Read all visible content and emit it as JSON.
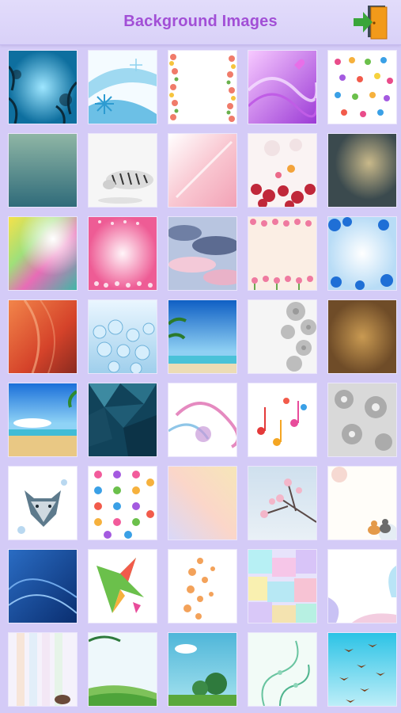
{
  "header": {
    "title": "Background Images"
  },
  "icons": {
    "exit": "exit-door-icon"
  },
  "tiles": [
    "blue-trees-thumbnail",
    "blue-snowflake-thumbnail",
    "flower-border-thumbnail",
    "purple-hearts-thumbnail",
    "butterflies-thumbnail",
    "teal-gradient-thumbnail",
    "white-tiger-thumbnail",
    "pink-feather-thumbnail",
    "red-roses-thumbnail",
    "dark-vintage-thumbnail",
    "rainbow-light-thumbnail",
    "pink-glow-thumbnail",
    "cloudy-sky-thumbnail",
    "pink-flowers-thumbnail",
    "blue-roses-thumbnail",
    "orange-silk-thumbnail",
    "water-drops-thumbnail",
    "tropical-beach-thumbnail",
    "grey-flowers-thumbnail",
    "brown-grunge-thumbnail",
    "beach-palm-thumbnail",
    "dark-polygon-thumbnail",
    "pink-swirl-thumbnail",
    "music-notes-thumbnail",
    "grey-floral-thumbnail",
    "wolf-watercolor-thumbnail",
    "paw-prints-thumbnail",
    "pastel-gradient-thumbnail",
    "cherry-blossom-thumbnail",
    "cat-watercolor-thumbnail",
    "blue-waves-thumbnail",
    "hummingbird-thumbnail",
    "orange-stars-thumbnail",
    "pastel-mosaic-thumbnail",
    "pastel-frame-thumbnail",
    "pastel-stripes-thumbnail",
    "grass-hills-thumbnail",
    "forest-sky-thumbnail",
    "green-swirls-thumbnail",
    "swallows-sky-thumbnail"
  ],
  "colors": {
    "background": "#d4cbf7",
    "title": "#a24fd6",
    "door_green": "#3aa53a",
    "door_orange": "#f29a1a"
  }
}
